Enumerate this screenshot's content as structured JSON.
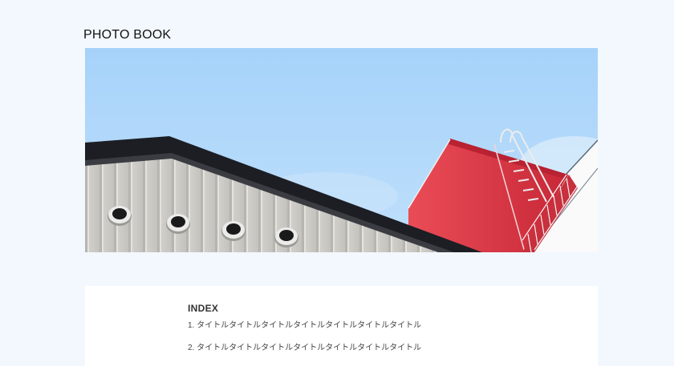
{
  "header": {
    "title": "PHOTO BOOK"
  },
  "hero": {
    "alt": "Corrugated building roof with vents and a red structure with a ladder against a blue sky",
    "colors": {
      "sky": "#aed6fa",
      "roof_edge": "#1c1e24",
      "wall": "#cfcdc8",
      "red_building": "#d9323f"
    }
  },
  "index": {
    "heading": "INDEX",
    "items": [
      {
        "number": "1.",
        "title": "タイトルタイトルタイトルタイトルタイトルタイトルタイトル"
      },
      {
        "number": "2.",
        "title": "タイトルタイトルタイトルタイトルタイトルタイトルタイトル"
      }
    ]
  }
}
